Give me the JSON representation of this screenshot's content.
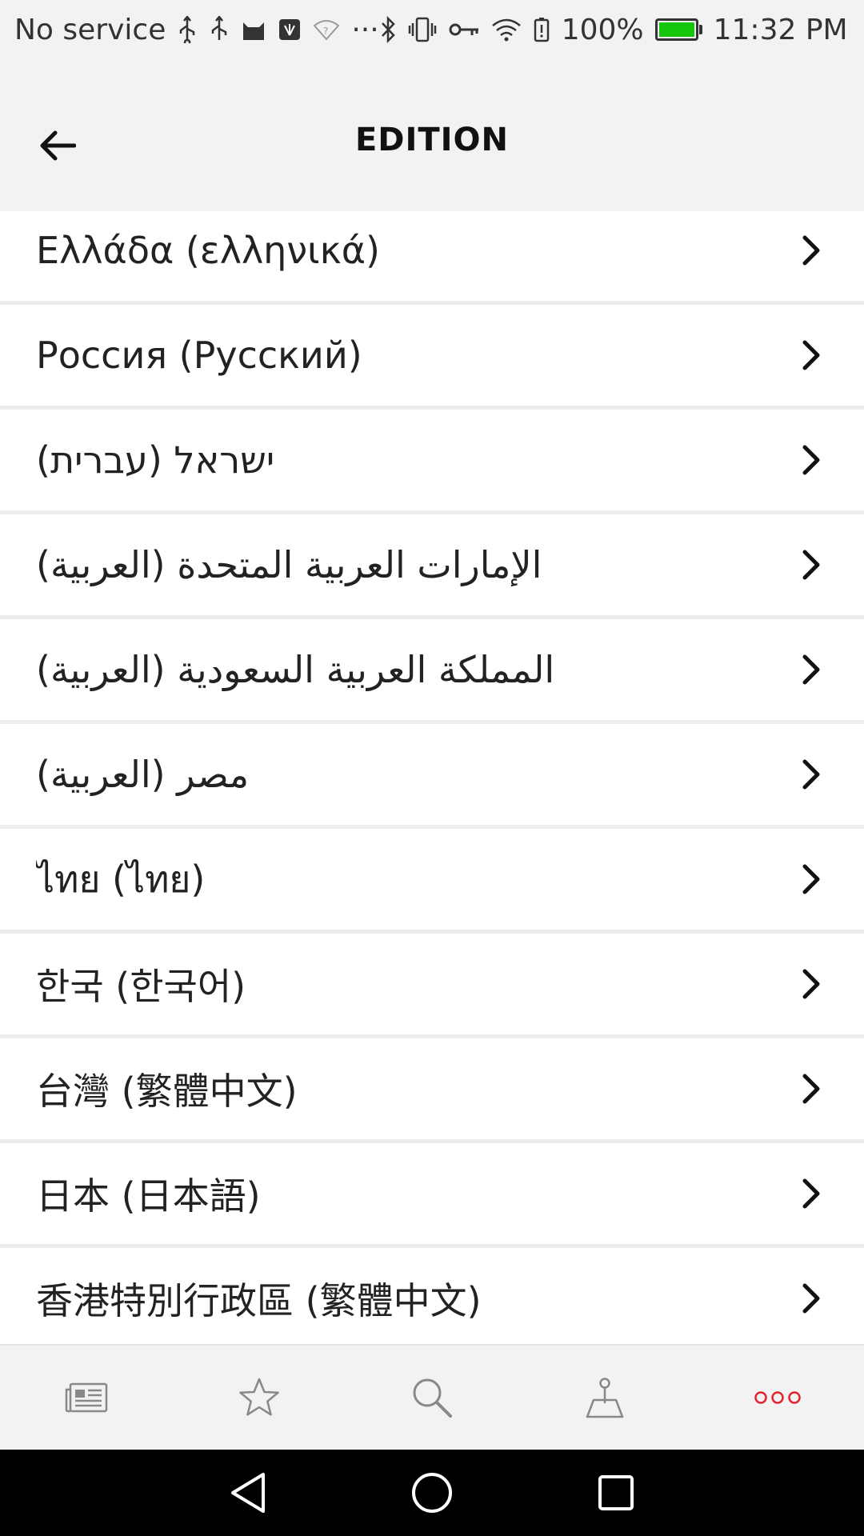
{
  "status_bar": {
    "carrier": "No service",
    "overflow": "···",
    "battery_percent": "100%",
    "battery_level": 1.0,
    "battery_color": "#16c60c",
    "time": "11:32 PM",
    "icons_left": [
      "usb-icon",
      "usb-icon",
      "cat-app-icon",
      "huawei-app-icon",
      "wifi-question-icon"
    ],
    "icons_right": [
      "bluetooth-icon",
      "vibrate-icon",
      "vpn-key-icon",
      "wifi-icon",
      "battery-alert-icon",
      "battery-icon"
    ]
  },
  "header": {
    "title": "EDITION",
    "back_icon": "arrow-left-icon"
  },
  "editions": [
    {
      "label": "Ελλάδα (ελληνικά)",
      "rtl": false
    },
    {
      "label": "Россия (Русский)",
      "rtl": false
    },
    {
      "label": "ישראל (עברית)",
      "rtl": true
    },
    {
      "label": "الإمارات العربية المتحدة (العربية)",
      "rtl": true
    },
    {
      "label": "المملكة العربية السعودية (العربية)",
      "rtl": true
    },
    {
      "label": "مصر (العربية)",
      "rtl": true
    },
    {
      "label": "ไทย (ไทย)",
      "rtl": false
    },
    {
      "label": "한국 (한국어)",
      "rtl": false
    },
    {
      "label": "台灣 (繁體中文)",
      "rtl": false
    },
    {
      "label": "日本 (日本語)",
      "rtl": false
    },
    {
      "label": "香港特別行政區 (繁體中文)",
      "rtl": false
    }
  ],
  "bottom_nav": {
    "items": [
      "news-icon",
      "star-icon",
      "search-icon",
      "map-pin-icon",
      "more-icon"
    ],
    "active_color": "#e0252f",
    "inactive_color": "#888888"
  },
  "system_nav": [
    "back-triangle-icon",
    "home-circle-icon",
    "recents-square-icon"
  ]
}
